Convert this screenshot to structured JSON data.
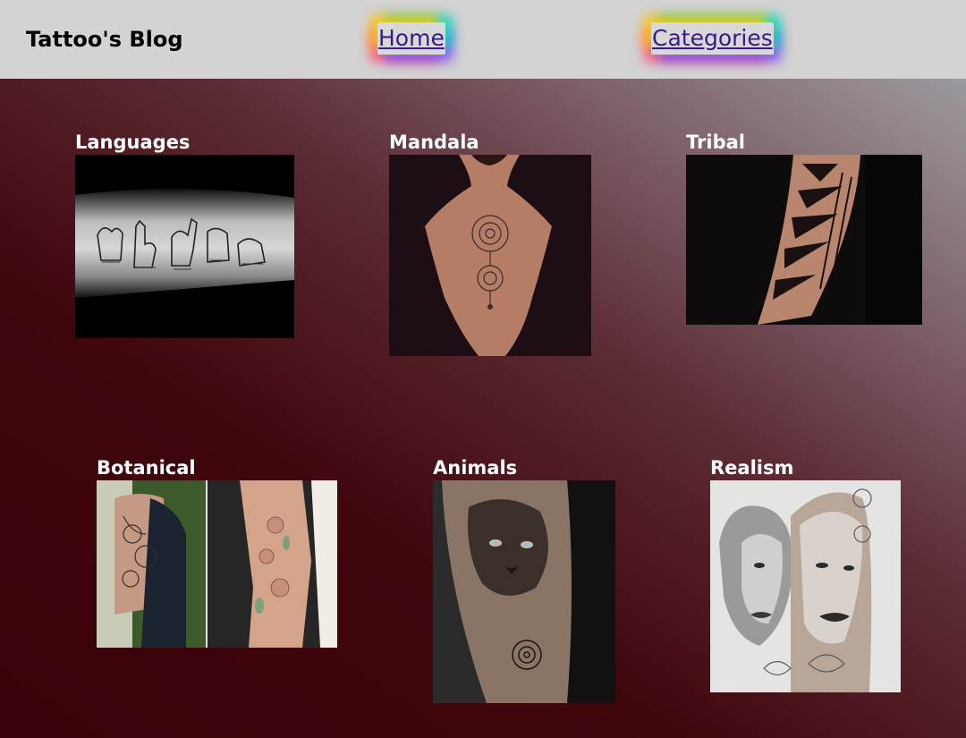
{
  "header": {
    "brand": "Tattoo's Blog",
    "nav": {
      "home": "Home",
      "categories": "Categories"
    }
  },
  "categories": [
    {
      "title": "Languages",
      "image": "sign-language-forearm-tattoo"
    },
    {
      "title": "Mandala",
      "image": "mandala-back-tattoo"
    },
    {
      "title": "Tribal",
      "image": "tribal-forearm-tattoo"
    },
    {
      "title": "Botanical",
      "image": "floral-arm-tattoos"
    },
    {
      "title": "Animals",
      "image": "lion-sleeve-tattoo"
    },
    {
      "title": "Realism",
      "image": "portrait-realism-tattoo"
    }
  ],
  "colors": {
    "header_bg": "#d3d3d3",
    "link": "#3b1a8a",
    "title": "#ffffff",
    "page_bg_dark": "#3a0208",
    "page_bg_light": "#9c9a9f"
  }
}
